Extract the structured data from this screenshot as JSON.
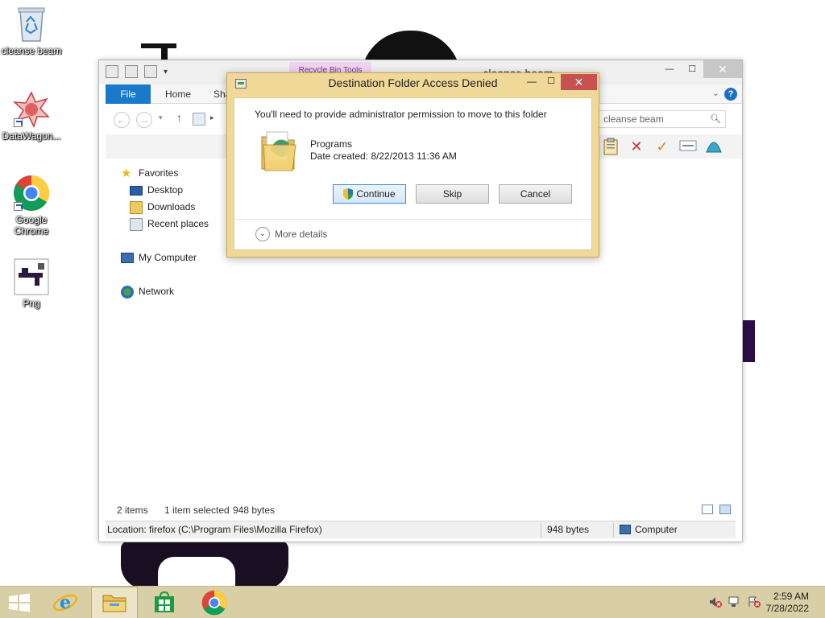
{
  "desktop": {
    "icons": [
      {
        "label": "cleanse beam",
        "icon": "recycle-bin-icon"
      },
      {
        "label": "DataWagon...",
        "icon": "datawagon-icon"
      },
      {
        "label": "Google Chrome",
        "icon": "chrome-icon"
      },
      {
        "label": "Png",
        "icon": "png-file-icon"
      }
    ]
  },
  "explorer": {
    "title": "cleanse beam",
    "contextual_tab": "Recycle Bin Tools",
    "tabs": {
      "file": "File",
      "home": "Home",
      "share": "Shar"
    },
    "search_placeholder": "cleanse beam",
    "nav": {
      "favorites": "Favorites",
      "desktop": "Desktop",
      "downloads": "Downloads",
      "recent": "Recent places",
      "computer": "My Computer",
      "network": "Network"
    },
    "status": {
      "items": "2 items",
      "selected": "1 item selected",
      "size": "948 bytes"
    },
    "details": {
      "location": "Location: firefox (C:\\Program Files\\Mozilla Firefox)",
      "size": "948 bytes",
      "computer": "Computer"
    }
  },
  "dialog": {
    "title": "Destination Folder Access Denied",
    "message": "You'll need to provide administrator permission to move to this folder",
    "item_name": "Programs",
    "item_date": "Date created: 8/22/2013 11:36 AM",
    "continue_label": "Continue",
    "skip_label": "Skip",
    "cancel_label": "Cancel",
    "more_details": "More details"
  },
  "taskbar": {
    "time": "2:59 AM",
    "date": "7/28/2022"
  },
  "colors": {
    "dialog_frame": "#f0d898",
    "close_red": "#c75050",
    "file_tab_blue": "#1979ca",
    "taskbar": "#d9cfa6"
  }
}
